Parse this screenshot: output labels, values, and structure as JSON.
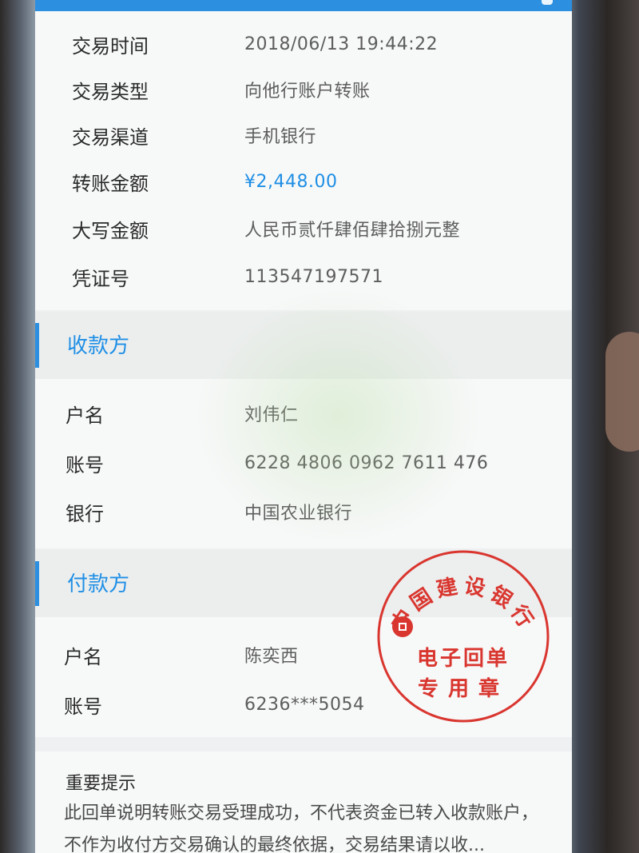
{
  "transaction": {
    "rows": [
      {
        "label": "交易时间",
        "value": "2018/06/13  19:44:22"
      },
      {
        "label": "交易类型",
        "value": "向他行账户转账"
      },
      {
        "label": "交易渠道",
        "value": "手机银行"
      },
      {
        "label": "转账金额",
        "value": "¥2,448.00"
      },
      {
        "label": "大写金额",
        "value": "人民币贰仟肆佰肆拾捌元整"
      },
      {
        "label": "凭证号",
        "value": "113547197571"
      }
    ]
  },
  "payee": {
    "title": "收款方",
    "rows": [
      {
        "label": "户名",
        "value": "刘伟仁"
      },
      {
        "label": "账号",
        "value": "6228 4806 0962 7611 476"
      },
      {
        "label": "银行",
        "value": "中国农业银行"
      }
    ]
  },
  "payer": {
    "title": "付款方",
    "rows": [
      {
        "label": "户名",
        "value": "陈奕西"
      },
      {
        "label": "账号",
        "value": "6236***5054"
      }
    ]
  },
  "notice": {
    "heading": "重要提示",
    "text": "此回单说明转账交易受理成功，不代表资金已转入收款账户，不作为收付方交易确认的最终依据，交易结果请以收..."
  },
  "stamp": {
    "bank_name": "中国建设银行",
    "line1": "电子回单",
    "line2": "专用章"
  },
  "colors": {
    "accent": "#2c8fe0",
    "stamp": "#d9362f"
  }
}
